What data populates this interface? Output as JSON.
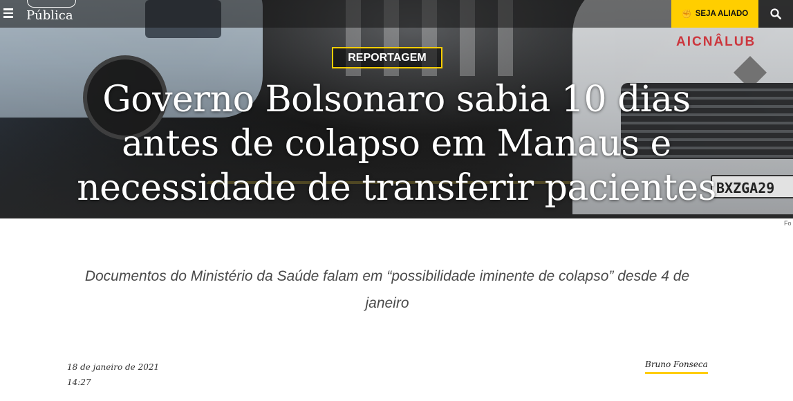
{
  "header": {
    "logo_text": "Pública",
    "cta_label": "SEJA ALIADO",
    "cta_icon": "fist-icon",
    "menu_icon": "hamburger-menu-icon",
    "search_icon": "search-icon",
    "accent_color": "#ffce00"
  },
  "hero": {
    "badge": "REPORTAGEM",
    "headline": "Governo Bolsonaro sabia 10 dias antes de colapso em Manaus e necessidade de transferir pacientes",
    "photo_credit": "Fo",
    "photo_text": {
      "van_word": "AICNÂLUB",
      "plate": "BXZGA29"
    }
  },
  "article": {
    "subtitle": "Documentos do Ministério da Saúde falam em “possibilidade iminente de colapso” desde 4 de janeiro",
    "date": "18 de janeiro de 2021",
    "time": "14:27",
    "author": "Bruno Fonseca"
  }
}
